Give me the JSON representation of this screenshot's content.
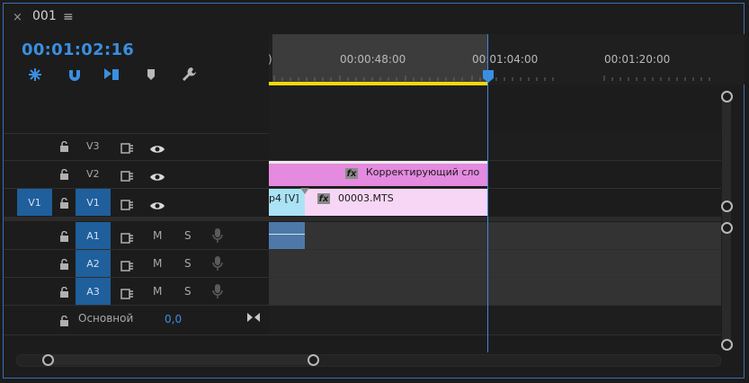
{
  "panel": {
    "close": "×",
    "title": "001",
    "menu": "≡",
    "timecode": "00:01:02:16"
  },
  "ruler": {
    "labels": [
      ")",
      "00:00:48:00",
      "00:01:04:00",
      "00:01:20:00"
    ]
  },
  "tracks": {
    "video": [
      {
        "label": "V3"
      },
      {
        "label": "V2"
      },
      {
        "label": "V1",
        "source": "V1"
      }
    ],
    "audio": [
      {
        "label": "A1",
        "mute": "M",
        "solo": "S"
      },
      {
        "label": "A2",
        "mute": "M",
        "solo": "S"
      },
      {
        "label": "A3",
        "mute": "M",
        "solo": "S"
      }
    ],
    "master": {
      "label": "Основной",
      "value": "0,0"
    }
  },
  "clips": {
    "adjustment": "Корректирующий сло",
    "v1_left": "p4 [V]",
    "v1_right": "00003.MTS",
    "fx": "fx"
  },
  "colors": {
    "accent": "#3a8fe0",
    "target": "#1f5f9b",
    "adjustment_clip": "#e48adf",
    "video_clip_a": "#aae3f5",
    "video_clip_b": "#f7d6f5",
    "audio_clip": "#4e78a8",
    "work_area": "#f5d90a"
  }
}
